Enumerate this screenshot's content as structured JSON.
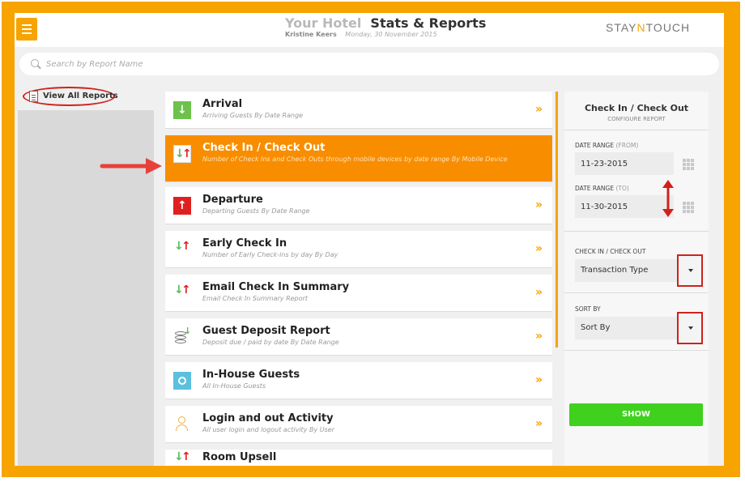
{
  "header": {
    "hotel_name": "Your Hotel",
    "title": "Stats & Reports",
    "user": "Kristine Keers",
    "date": "Monday, 30 November 2015",
    "brand_left": "STAY",
    "brand_mid": "N",
    "brand_right": "TOUCH"
  },
  "search": {
    "placeholder": "Search by Report Name"
  },
  "sidebar": {
    "view_all_label": "View All Reports"
  },
  "reports": [
    {
      "name": "Arrival",
      "desc": "Arriving Guests By Date Range",
      "icon": "arrival-icon"
    },
    {
      "name": "Check In / Check Out",
      "desc": "Number of Check Ins and Check Outs through mobile devices by date range By Mobile Device",
      "icon": "checkin-checkout-icon",
      "active": true
    },
    {
      "name": "Departure",
      "desc": "Departing Guests By Date Range",
      "icon": "departure-icon"
    },
    {
      "name": "Early Check In",
      "desc": "Number of Early Check-ins by day By Day",
      "icon": "early-checkin-icon"
    },
    {
      "name": "Email Check In Summary",
      "desc": "Email Check In Summary Report",
      "icon": "email-checkin-icon"
    },
    {
      "name": "Guest Deposit Report",
      "desc": "Deposit due / paid by date By Date Range",
      "icon": "deposit-coins-icon"
    },
    {
      "name": "In-House Guests",
      "desc": "All In-House Guests",
      "icon": "in-house-icon"
    },
    {
      "name": "Login and out Activity",
      "desc": "All user login and logout activity By User",
      "icon": "user-activity-icon"
    },
    {
      "name": "Room Upsell",
      "desc": "",
      "icon": "room-upsell-icon"
    }
  ],
  "chevron": "»",
  "panel": {
    "title": "Check In / Check Out",
    "subtitle": "Configure Report",
    "from_label": "Date Range",
    "from_hint": "(From)",
    "from_value": "11-23-2015",
    "to_label": "Date Range",
    "to_hint": "(To)",
    "to_value": "11-30-2015",
    "type_label": "Check In / Check Out",
    "type_value": "Transaction Type",
    "sort_label": "Sort By",
    "sort_value": "Sort By",
    "show_label": "SHOW"
  },
  "colors": {
    "accent": "#f7a300",
    "active": "#f98d00",
    "show": "#3fd11d",
    "annotation": "#d0211b"
  }
}
